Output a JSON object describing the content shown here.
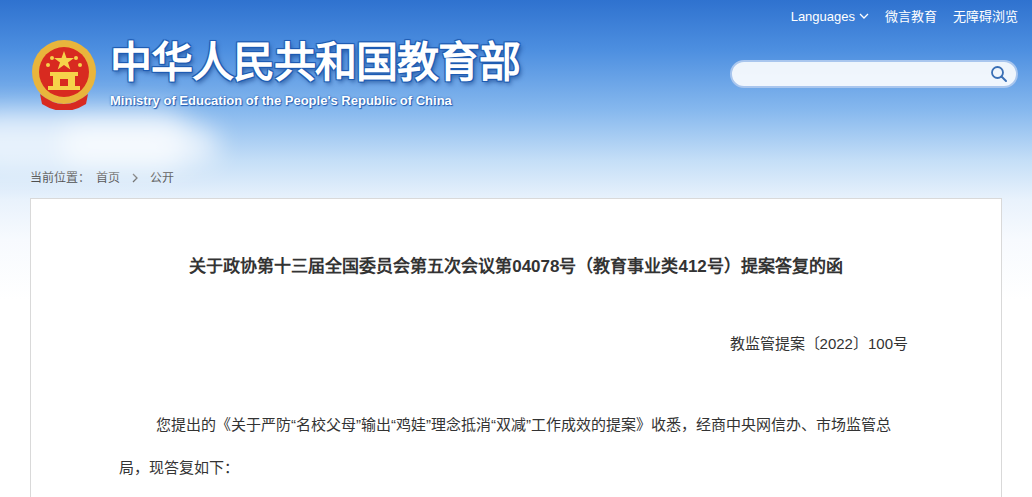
{
  "top_links": [
    {
      "label": "Languages",
      "dropdown": true
    },
    {
      "label": "微言教育",
      "dropdown": false
    },
    {
      "label": "无障碍浏览",
      "dropdown": false
    }
  ],
  "site": {
    "title": "中华人民共和国教育部",
    "subtitle": "Ministry of Education of the People's Republic of China"
  },
  "breadcrumb": {
    "label": "当前位置：",
    "items": [
      "首页",
      "公开"
    ]
  },
  "article": {
    "title": "关于政协第十三届全国委员会第五次会议第04078号（教育事业类412号）提案答复的函",
    "doc_number": "教监管提案〔2022〕100号",
    "paragraphs": [
      "您提出的《关于严防“名校父母”输出“鸡娃”理念抵消“双减”工作成效的提案》收悉，经商中央网信办、市场监管总局，现答复如下："
    ]
  }
}
